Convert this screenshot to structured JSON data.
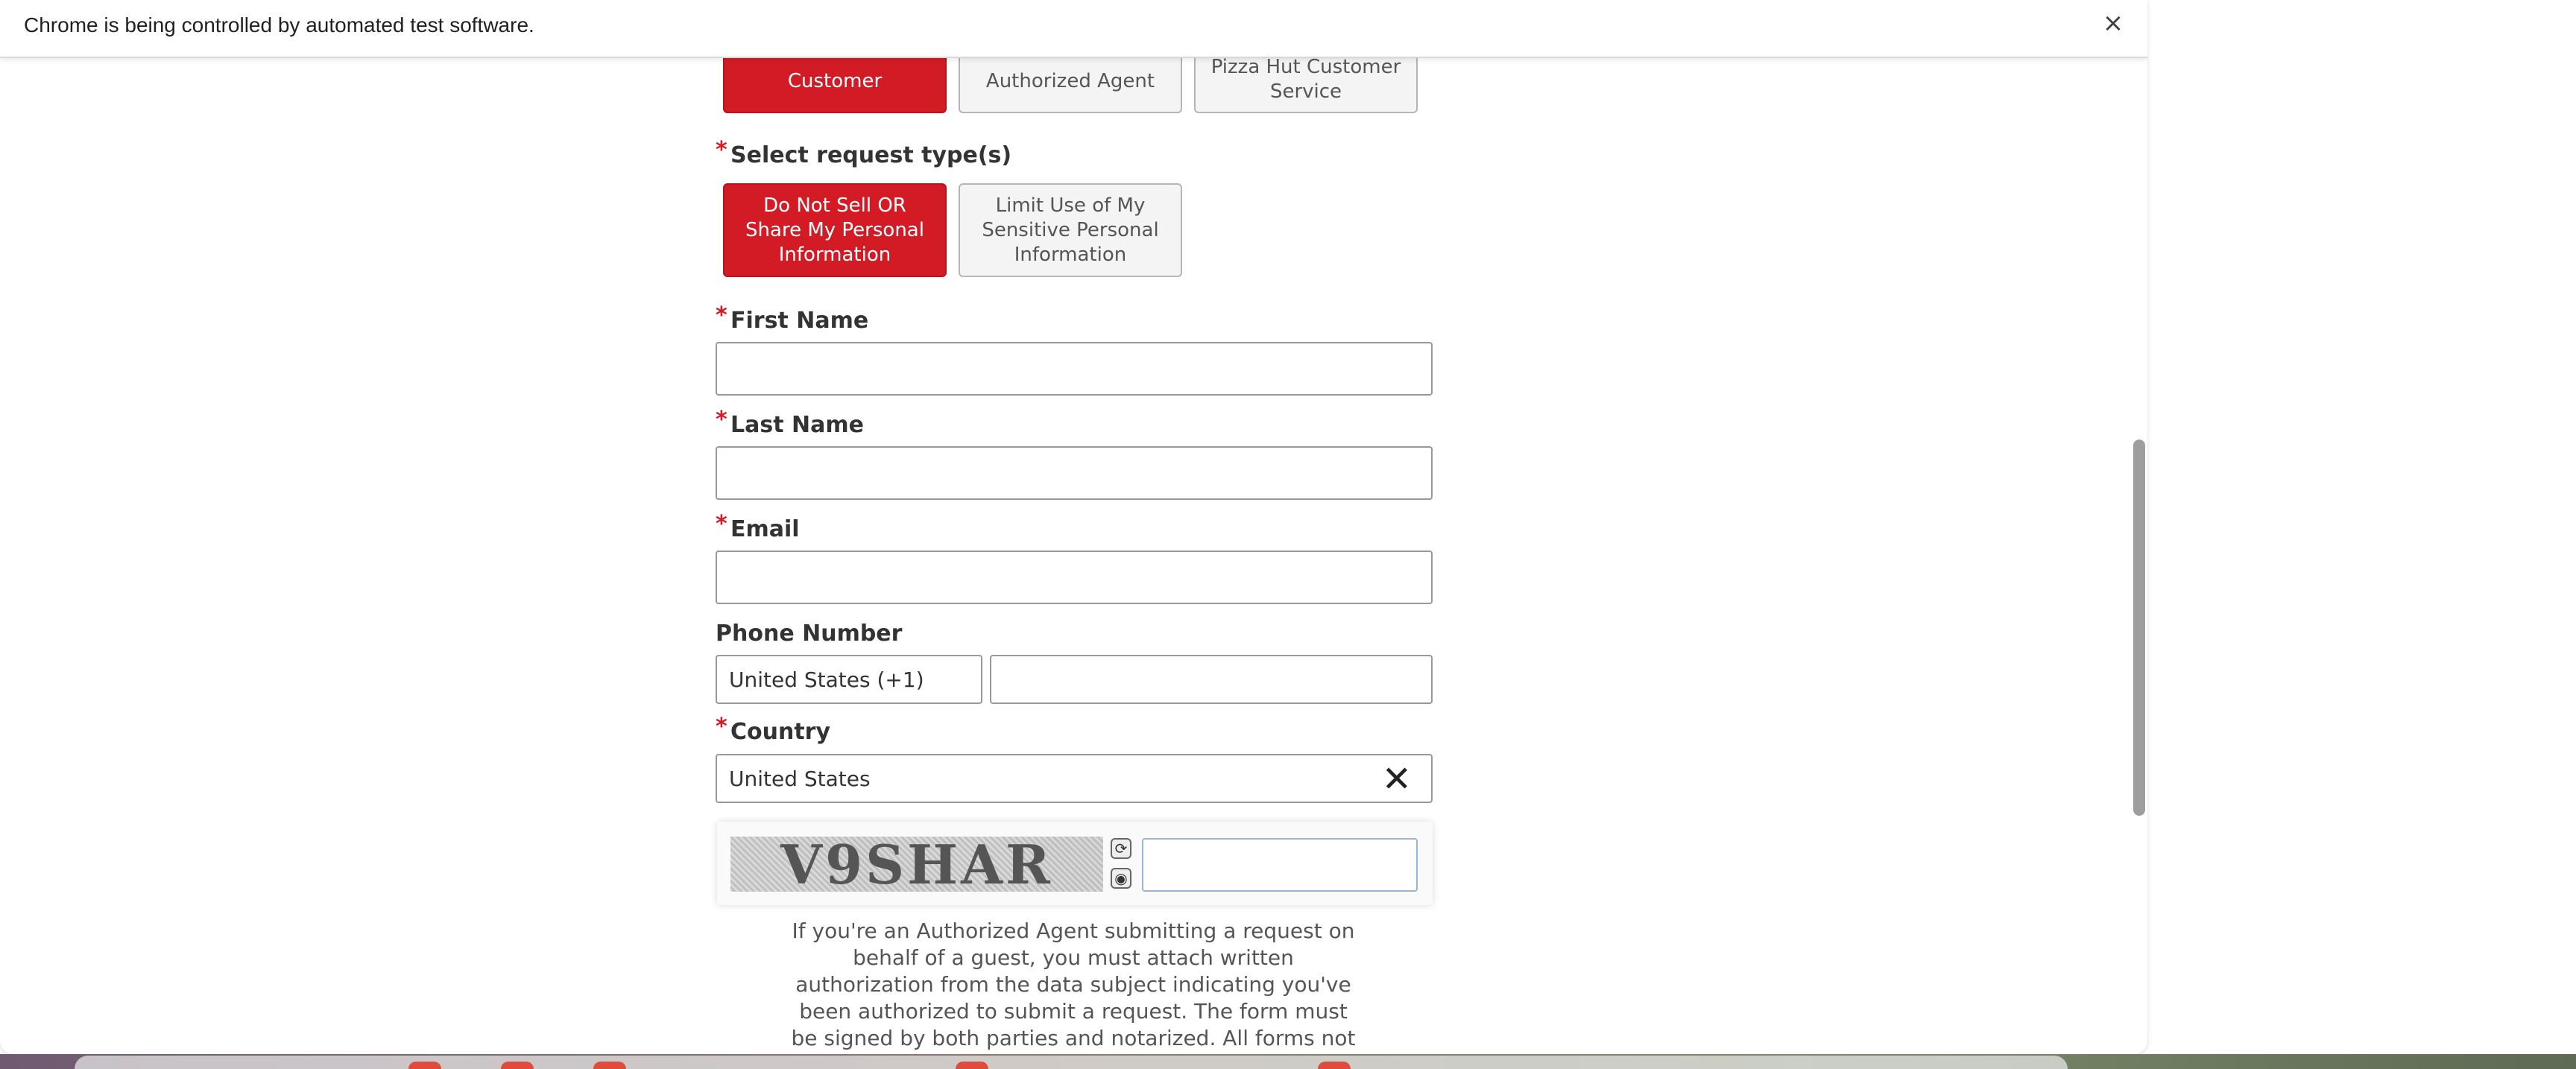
{
  "browser": {
    "infobar_text": "Chrome is being controlled by automated test software.",
    "close_symbol": "×"
  },
  "requester_type": {
    "options": [
      {
        "label": "Customer",
        "selected": true
      },
      {
        "label": "Authorized Agent",
        "selected": false
      },
      {
        "label": "Pizza Hut Customer Service",
        "selected": false
      }
    ]
  },
  "request_type": {
    "label": "Select request type(s)",
    "required_mark": "*",
    "options": [
      {
        "label": "Do Not Sell OR Share My Personal Information",
        "selected": true
      },
      {
        "label": "Limit Use of My Sensitive Personal Information",
        "selected": false
      }
    ]
  },
  "form": {
    "first_name": {
      "label": "First Name",
      "required_mark": "*",
      "value": ""
    },
    "last_name": {
      "label": "Last Name",
      "required_mark": "*",
      "value": ""
    },
    "email": {
      "label": "Email",
      "required_mark": "*",
      "value": ""
    },
    "phone": {
      "label": "Phone Number",
      "country_code": "United States (+1)",
      "value": ""
    },
    "country": {
      "label": "Country",
      "required_mark": "*",
      "value": "United States"
    }
  },
  "captcha": {
    "image_text": "V9SHAR",
    "refresh_icon": "refresh-icon",
    "audio_icon": "audio-icon",
    "value": ""
  },
  "notice": {
    "text": "If you're an Authorized Agent submitting a request on behalf of a guest, you must attach written authorization from the data subject indicating you've been authorized to submit a request. The form must be signed by both parties and notarized. All forms not signed and notarized will be"
  },
  "colors": {
    "brand_red": "#d31b25",
    "required_red": "#d31b25"
  }
}
